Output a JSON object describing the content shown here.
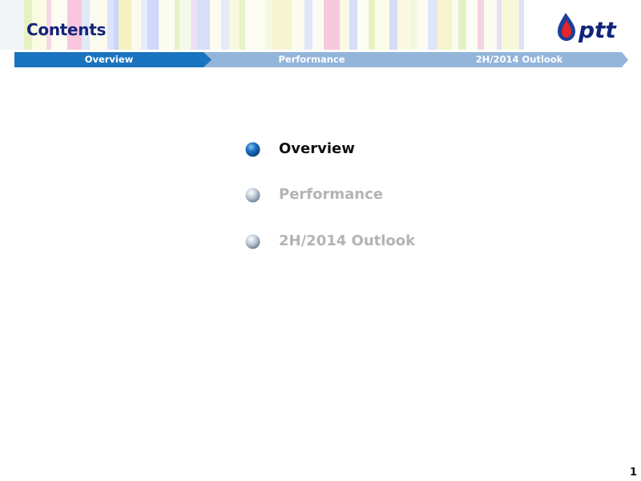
{
  "header": {
    "title": "Contents"
  },
  "brand": {
    "logo_text": "ptt",
    "logo_color": "#12247a",
    "drop_color": "#e3262b"
  },
  "nav": {
    "tabs": [
      {
        "label": "Overview",
        "state": "active",
        "color": "#1a73be"
      },
      {
        "label": "Performance",
        "state": "inactive",
        "color": "#93b5da"
      },
      {
        "label": "2H/2014 Outlook",
        "state": "inactive",
        "color": "#93b5da"
      }
    ]
  },
  "agenda": {
    "items": [
      {
        "label": "Overview",
        "state": "active"
      },
      {
        "label": "Performance",
        "state": "inactive"
      },
      {
        "label": "2H/2014 Outlook",
        "state": "inactive"
      }
    ]
  },
  "footer": {
    "page_number": "1"
  }
}
